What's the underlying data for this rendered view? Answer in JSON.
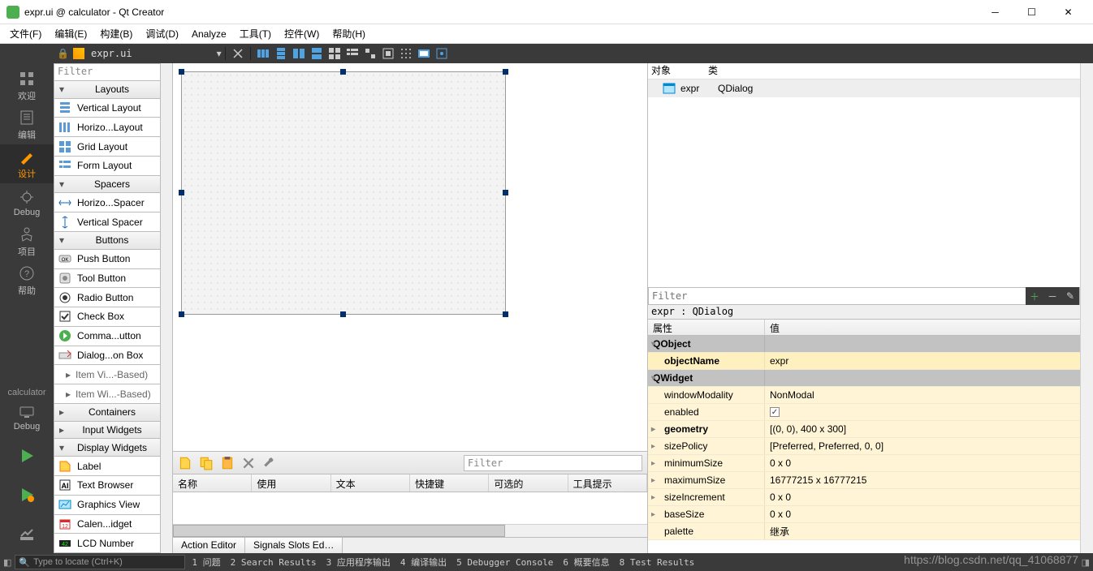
{
  "title": "expr.ui @ calculator - Qt Creator",
  "menu": [
    "文件(F)",
    "编辑(E)",
    "构建(B)",
    "调试(D)",
    "Analyze",
    "工具(T)",
    "控件(W)",
    "帮助(H)"
  ],
  "toolbar_file": "expr.ui",
  "modes": {
    "welcome": "欢迎",
    "edit": "编辑",
    "design": "设计",
    "debug": "Debug",
    "projects": "项目",
    "help": "帮助",
    "kit": "calculator",
    "kitDebug": "Debug"
  },
  "widgetbox": {
    "filter": "Filter",
    "layouts_hdr": "Layouts",
    "layouts": [
      "Vertical Layout",
      "Horizo...Layout",
      "Grid Layout",
      "Form Layout"
    ],
    "spacers_hdr": "Spacers",
    "spacers": [
      "Horizo...Spacer",
      "Vertical Spacer"
    ],
    "buttons_hdr": "Buttons",
    "buttons": [
      "Push Button",
      "Tool Button",
      "Radio Button",
      "Check Box",
      "Comma...utton",
      "Dialog...on Box"
    ],
    "itemviews1": "Item Vi...-Based)",
    "itemviews2": "Item Wi...-Based)",
    "containers_hdr": "Containers",
    "input_hdr": "Input Widgets",
    "display_hdr": "Display Widgets",
    "display": [
      "Label",
      "Text Browser",
      "Graphics View",
      "Calen...idget",
      "LCD Number"
    ]
  },
  "action_header": [
    "名称",
    "使用",
    "文本",
    "快捷键",
    "可选的",
    "工具提示"
  ],
  "action_tabs": [
    "Action Editor",
    "Signals  Slots Ed…"
  ],
  "action_filter": "Filter",
  "objtree": {
    "hdr_obj": "对象",
    "hdr_cls": "类",
    "row_obj": "expr",
    "row_cls": "QDialog"
  },
  "prop_filter": "Filter",
  "typeline": "expr : QDialog",
  "prop_hdr": {
    "c1": "属性",
    "c2": "值"
  },
  "props": [
    {
      "k": "QObject",
      "cat": true
    },
    {
      "k": "objectName",
      "v": "expr",
      "bold": true,
      "cls": "obj"
    },
    {
      "k": "QWidget",
      "cat": true
    },
    {
      "k": "windowModality",
      "v": "NonModal",
      "cls": "wid"
    },
    {
      "k": "enabled",
      "v": "[check]",
      "cls": "wid"
    },
    {
      "k": "geometry",
      "v": "[(0, 0), 400 x 300]",
      "bold": true,
      "cls": "wid",
      "exp": true
    },
    {
      "k": "sizePolicy",
      "v": "[Preferred, Preferred, 0, 0]",
      "cls": "wid",
      "exp": true
    },
    {
      "k": "minimumSize",
      "v": "0 x 0",
      "cls": "wid",
      "exp": true
    },
    {
      "k": "maximumSize",
      "v": "16777215 x 16777215",
      "cls": "wid",
      "exp": true
    },
    {
      "k": "sizeIncrement",
      "v": "0 x 0",
      "cls": "wid",
      "exp": true
    },
    {
      "k": "baseSize",
      "v": "0 x 0",
      "cls": "wid",
      "exp": true
    },
    {
      "k": "palette",
      "v": "继承",
      "cls": "wid"
    }
  ],
  "status": {
    "search_placeholder": "Type to locate (Ctrl+K)",
    "items": [
      "1 问题",
      "2 Search Results",
      "3 应用程序输出",
      "4 编译输出",
      "5 Debugger Console",
      "6 概要信息",
      "8 Test Results"
    ]
  },
  "watermark": "https://blog.csdn.net/qq_41068877"
}
